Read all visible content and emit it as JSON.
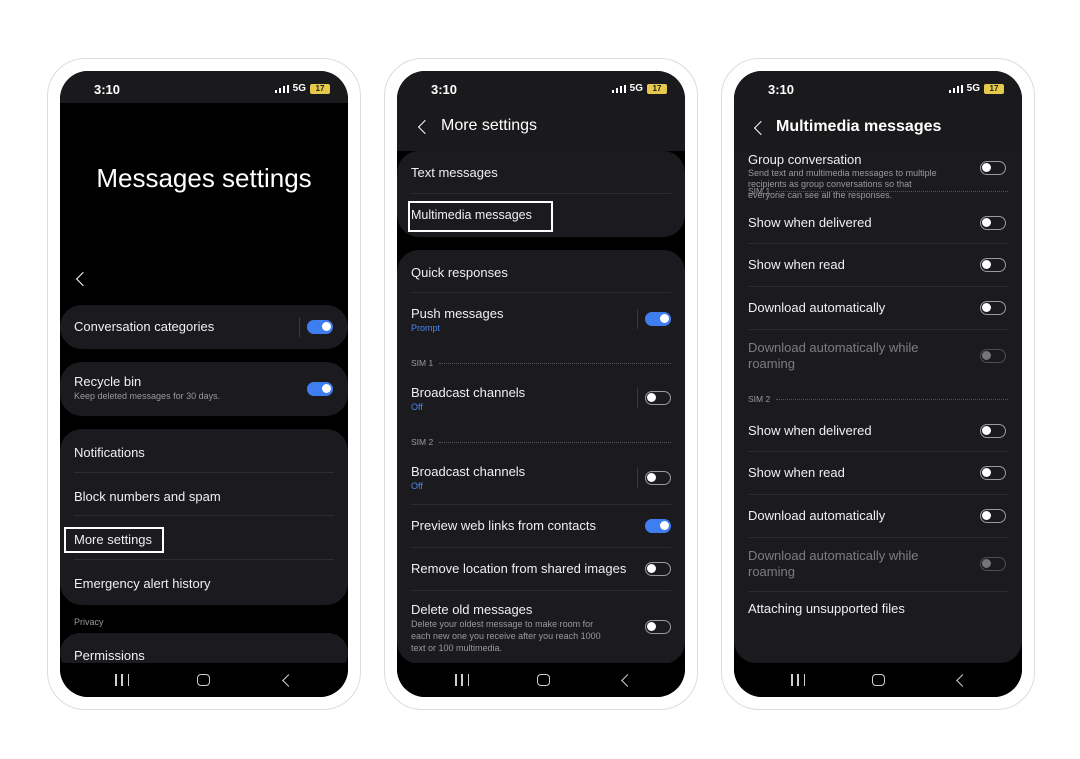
{
  "phone1": {
    "time": "3:10",
    "network": "5G",
    "battery": "17",
    "title": "Messages settings",
    "conversation_categories": "Conversation categories",
    "recycle_bin": "Recycle bin",
    "recycle_bin_sub": "Keep deleted messages for 30 days.",
    "notifications": "Notifications",
    "block_numbers": "Block numbers and spam",
    "more_settings": "More settings",
    "emergency_alert": "Emergency alert history",
    "privacy": "Privacy",
    "permissions": "Permissions"
  },
  "phone2": {
    "time": "3:10",
    "network": "5G",
    "battery": "17",
    "title": "More settings",
    "text_messages": "Text messages",
    "multimedia_messages": "Multimedia messages",
    "quick_responses": "Quick responses",
    "push_messages": "Push messages",
    "push_sub": "Prompt",
    "sim1": "SIM 1",
    "broadcast1": "Broadcast channels",
    "broadcast1_sub": "Off",
    "sim2": "SIM 2",
    "broadcast2": "Broadcast channels",
    "broadcast2_sub": "Off",
    "preview_links": "Preview web links from contacts",
    "remove_location": "Remove location from shared images",
    "delete_old": "Delete old messages",
    "delete_old_sub1": "Delete your oldest message to make room for",
    "delete_old_sub2": "each new one you receive after you reach 1000",
    "delete_old_sub3": "text or 100 multimedia."
  },
  "phone3": {
    "time": "3:10",
    "network": "5G",
    "battery": "17",
    "title": "Multimedia messages",
    "group_conversation": "Group conversation",
    "group_sub1": "Send text and multimedia messages to multiple",
    "group_sub2": "recipients as group conversations so that",
    "group_sub3": "everyone can see all the responses.",
    "sim1": "SIM 1",
    "sim2": "SIM 2",
    "show_delivered_1": "Show when delivered",
    "show_read_1": "Show when read",
    "download_auto_1": "Download automatically",
    "download_roam_1a": "Download automatically while",
    "download_roam_1b": "roaming",
    "show_delivered_2": "Show when delivered",
    "show_read_2": "Show when read",
    "download_auto_2": "Download automatically",
    "download_roam_2a": "Download automatically while",
    "download_roam_2b": "roaming",
    "attaching": "Attaching unsupported files"
  },
  "colors": {
    "accent": "#3f7ef0",
    "background": "#000000",
    "card": "#1b1b1f",
    "highlight": "#ffffff"
  },
  "icons": [
    "signal-icon",
    "battery-icon",
    "back-chevron-icon",
    "nav-recents-icon",
    "nav-home-icon",
    "nav-back-icon"
  ]
}
